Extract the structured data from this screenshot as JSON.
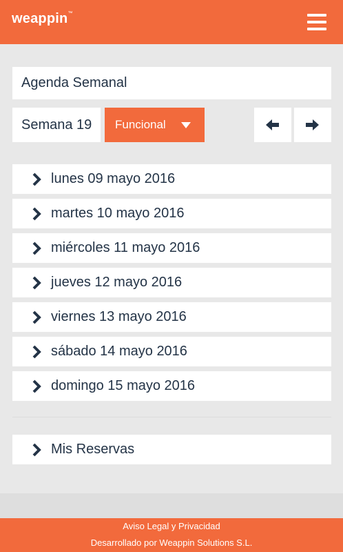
{
  "header": {
    "logo": "weappin",
    "logo_tm": "™",
    "menu_icon": "hamburger-menu-icon"
  },
  "title": "Agenda Semanal",
  "week": {
    "label": "Semana 19"
  },
  "filter": {
    "selected": "Funcional"
  },
  "nav": {
    "prev_icon": "arrow-left-icon",
    "next_icon": "arrow-right-icon"
  },
  "days": [
    {
      "label": "lunes 09 mayo 2016"
    },
    {
      "label": "martes 10 mayo 2016"
    },
    {
      "label": "miércoles 11 mayo 2016"
    },
    {
      "label": "jueves 12 mayo 2016"
    },
    {
      "label": "viernes 13 mayo 2016"
    },
    {
      "label": "sábado 14 mayo 2016"
    },
    {
      "label": "domingo 15 mayo 2016"
    }
  ],
  "reservations": {
    "label": "Mis Reservas"
  },
  "footer": {
    "legal": "Aviso Legal y Privacidad",
    "credits": "Desarrollado por Weappin Solutions S.L."
  },
  "colors": {
    "brand": "#f26a3c",
    "text": "#243447",
    "background": "#e8e8e8"
  }
}
